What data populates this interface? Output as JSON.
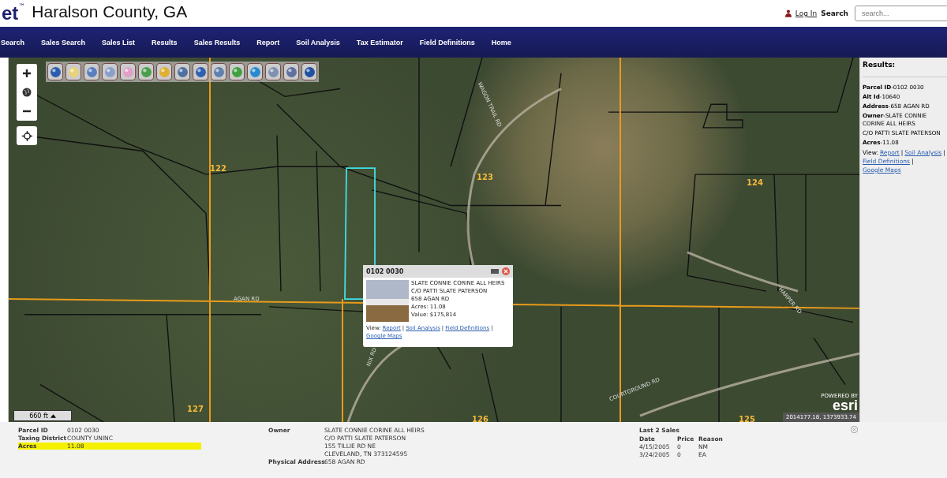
{
  "header": {
    "logo_text": "et",
    "logo_mark": "™",
    "title": "Haralson County, GA",
    "login": "Log In",
    "search_label": "Search",
    "search_placeholder": "search..."
  },
  "nav": [
    {
      "label": "Search"
    },
    {
      "label": "Sales Search"
    },
    {
      "label": "Sales List"
    },
    {
      "label": "Results"
    },
    {
      "label": "Sales Results"
    },
    {
      "label": "Report"
    },
    {
      "label": "Soil Analysis"
    },
    {
      "label": "Tax Estimator"
    },
    {
      "label": "Field Definitions"
    },
    {
      "label": "Home"
    }
  ],
  "map": {
    "labels": [
      {
        "text": "122",
        "kind": "section"
      },
      {
        "text": "123",
        "kind": "section"
      },
      {
        "text": "124",
        "kind": "section"
      },
      {
        "text": "127",
        "kind": "section"
      },
      {
        "text": "126",
        "kind": "section"
      },
      {
        "text": "125",
        "kind": "section"
      },
      {
        "text": "AGAN RD",
        "kind": "road"
      },
      {
        "text": "WAGON TRAIL RD",
        "kind": "road"
      },
      {
        "text": "HARPER RD",
        "kind": "road"
      },
      {
        "text": "NIX RD",
        "kind": "road"
      },
      {
        "text": "COURTGROUND RD",
        "kind": "road"
      }
    ],
    "scale": "660 ft",
    "coordinates": "2014177.18, 1373933.74",
    "attribution": {
      "powered": "POWERED BY",
      "logo": "esri"
    },
    "popup": {
      "title": "0102 0030",
      "lines": [
        "SLATE CONNIE CORINE ALL HEIRS",
        "C/O PATTI SLATE PATERSON",
        "658 AGAN RD",
        "Acres: 11.08",
        "Value: $175,814"
      ],
      "view_label": "View:",
      "links": [
        "Report",
        "Soil Analysis",
        "Field Definitions",
        "Google Maps"
      ],
      "link_separator": "|"
    }
  },
  "results": {
    "title": "Results:",
    "fields": [
      {
        "label": "Parcel ID",
        "value": "0102 0030"
      },
      {
        "label": "Alt Id",
        "value": "10640"
      },
      {
        "label": "Address",
        "value": "658 AGAN RD"
      },
      {
        "label": "Owner",
        "value": "SLATE CONNIE CORINE ALL HEIRS"
      },
      {
        "value": "C/O PATTI SLATE PATERSON"
      },
      {
        "label": "Acres",
        "value": "11.08"
      }
    ],
    "field_separator": "-",
    "view_label": "View:",
    "links": [
      "Report",
      "Soil Analysis",
      "Field Definitions",
      "Google Maps"
    ],
    "link_separator": "|"
  },
  "details": {
    "fields": [
      {
        "label": "Parcel ID",
        "value": "0102 0030",
        "highlighted": false
      },
      {
        "label": "Taxing District",
        "value": "COUNTY UNINC",
        "highlighted": false
      },
      {
        "label": "Acres",
        "value": "11.08",
        "highlighted": true
      }
    ],
    "owner_label": "Owner",
    "owner_lines": [
      "SLATE CONNIE CORINE ALL HEIRS",
      "C/O PATTI SLATE PATERSON",
      "155 TILLIE RD NE",
      "CLEVELAND, TN 373124595"
    ],
    "address_label": "Physical Address",
    "address": "658 AGAN RD",
    "sales": {
      "title": "Last 2 Sales",
      "columns": [
        "Date",
        "Price",
        "Reason"
      ],
      "rows": [
        [
          "4/15/2005",
          "0",
          "NM"
        ],
        [
          "3/24/2005",
          "0",
          "EA"
        ]
      ]
    }
  }
}
